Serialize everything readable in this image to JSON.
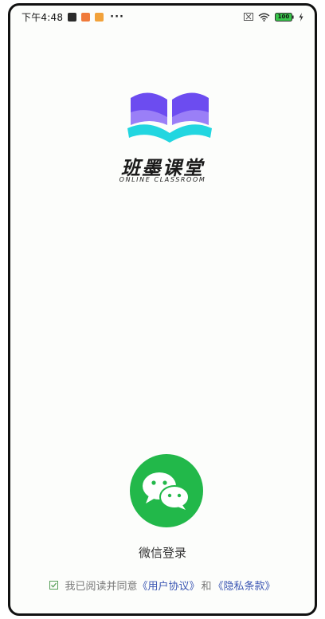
{
  "status_bar": {
    "time": "下午4:48",
    "more": "···",
    "battery": "100",
    "icons": [
      "notification-app-icon",
      "notification-app-icon-2",
      "notification-app-icon-3",
      "sim-off-icon",
      "wifi-icon",
      "battery-icon",
      "charging-icon"
    ]
  },
  "brand": {
    "name": "班墨课堂",
    "subtitle": "ONLINE CLASSROOM",
    "colors": {
      "book_purple": "#6c4cf0",
      "book_light": "#9a7ff7",
      "book_cyan": "#22d6e0"
    }
  },
  "login": {
    "wechat_label": "微信登录",
    "wechat_color": "#22b84a"
  },
  "agreement": {
    "prefix": "我已阅读并同意",
    "user_agreement": "《用户协议》",
    "and": "和",
    "privacy_policy": "《隐私条款》",
    "checked": true
  }
}
